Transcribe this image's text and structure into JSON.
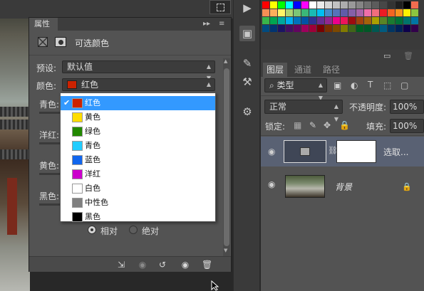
{
  "properties_panel": {
    "tab_label": "属性",
    "header_title": "可选颜色",
    "preset_label": "预设:",
    "preset_value": "默认值",
    "colors_label": "颜色:",
    "colors_value": "红色",
    "colors_swatch_color": "#cc2200",
    "slider_labels": [
      "青色:",
      "洋红:",
      "黄色:",
      "黑色:"
    ],
    "method_options": [
      "相对",
      "绝对"
    ],
    "selected_method": "相对"
  },
  "dropdown": {
    "selected_index": 0,
    "items": [
      {
        "label": "红色",
        "color": "#cc2200"
      },
      {
        "label": "黄色",
        "color": "#ffdd00"
      },
      {
        "label": "绿色",
        "color": "#228800"
      },
      {
        "label": "青色",
        "color": "#22ccff"
      },
      {
        "label": "蓝色",
        "color": "#1166ee"
      },
      {
        "label": "洋红",
        "color": "#cc00cc"
      },
      {
        "label": "白色",
        "color": "#ffffff"
      },
      {
        "label": "中性色",
        "color": "#808080"
      },
      {
        "label": "黑色",
        "color": "#000000"
      }
    ]
  },
  "layers_panel": {
    "tabs": [
      "图层",
      "通道",
      "路径"
    ],
    "filter_label": "类型",
    "blend_mode": "正常",
    "opacity_label": "不透明度:",
    "opacity_value": "100%",
    "lock_label": "锁定:",
    "fill_label": "填充:",
    "fill_value": "100%",
    "layers": [
      {
        "name": "选取...",
        "selected": true
      },
      {
        "name": "背景",
        "locked": true
      }
    ]
  },
  "colors": {
    "accent": "#3399ff",
    "panel_bg": "#535353",
    "dark_bg": "#3a3a3a"
  }
}
